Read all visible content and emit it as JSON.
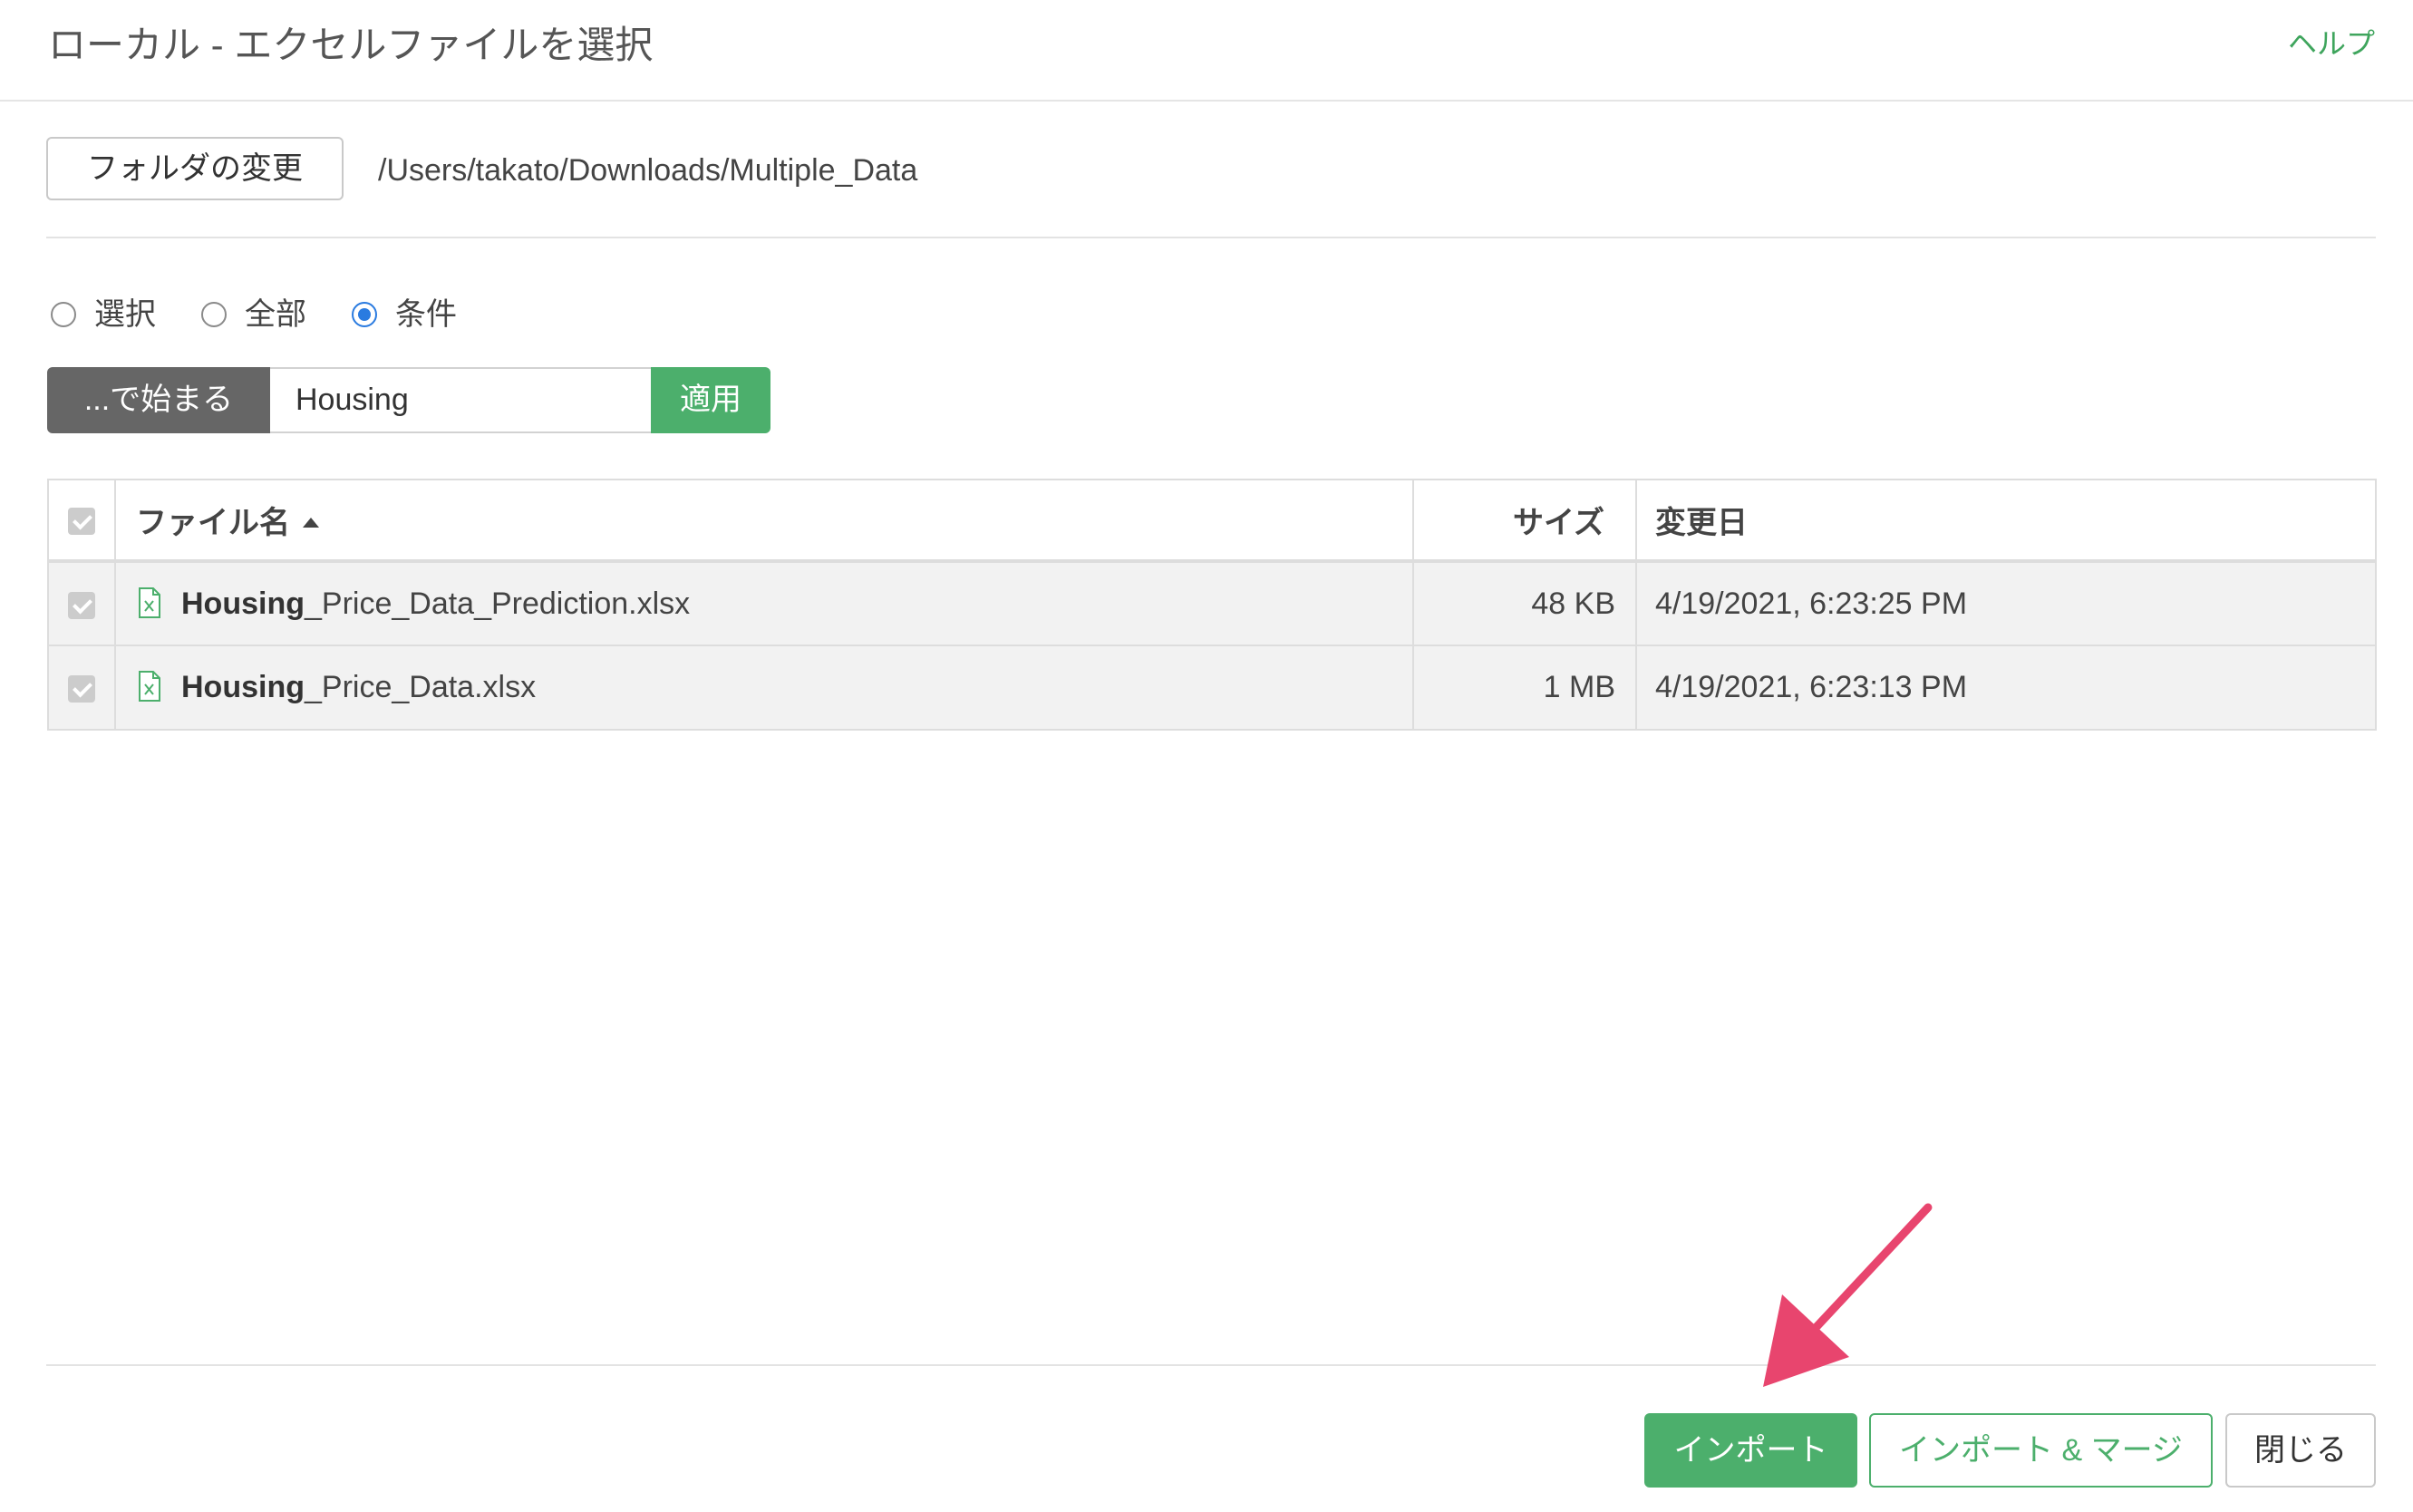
{
  "header": {
    "title": "ローカル - エクセルファイルを選択",
    "help_label": "ヘルプ"
  },
  "folder": {
    "change_button_label": "フォルダの変更",
    "path": "/Users/takato/Downloads/Multiple_Data"
  },
  "selection_mode": {
    "options": [
      {
        "label": "選択",
        "checked": false
      },
      {
        "label": "全部",
        "checked": false
      },
      {
        "label": "条件",
        "checked": true
      }
    ]
  },
  "condition": {
    "operator_label": "...で始まる",
    "value": "Housing",
    "apply_label": "適用"
  },
  "file_table": {
    "columns": {
      "name": "ファイル名",
      "size": "サイズ",
      "modified": "変更日"
    },
    "sort": {
      "column": "name",
      "direction": "ascending"
    },
    "rows": [
      {
        "name_match": "Housing",
        "name_rest": "_Price_Data_Prediction.xlsx",
        "size": "48 KB",
        "modified": "4/19/2021, 6:23:25 PM",
        "checked": true,
        "icon": "excel-file-icon"
      },
      {
        "name_match": "Housing",
        "name_rest": "_Price_Data.xlsx",
        "size": "1 MB",
        "modified": "4/19/2021, 6:23:13 PM",
        "checked": true,
        "icon": "excel-file-icon"
      }
    ]
  },
  "footer": {
    "import_label": "インポート",
    "import_merge_label": "インポート & マージ",
    "close_label": "閉じる"
  },
  "colors": {
    "accent_green": "#4caf6c",
    "help_link_green": "#3fa55d",
    "radio_blue": "#2a7be0",
    "annotation_arrow": "#e8456e"
  }
}
